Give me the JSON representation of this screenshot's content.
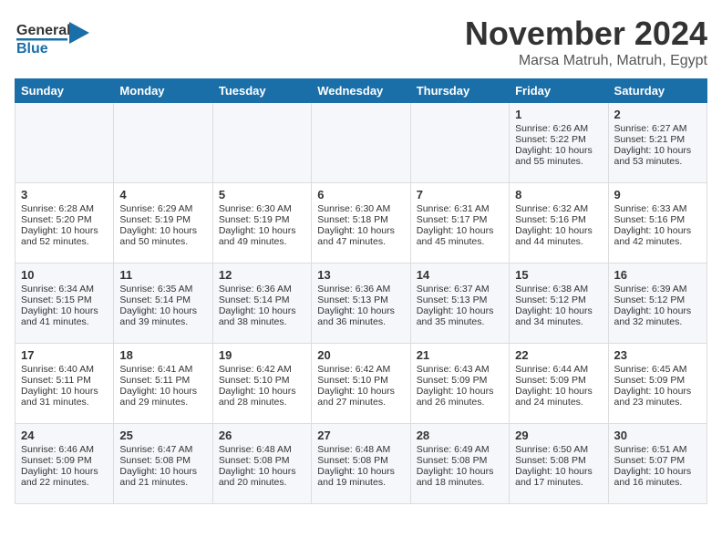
{
  "header": {
    "logo_line1": "General",
    "logo_line2": "Blue",
    "month": "November 2024",
    "location": "Marsa Matruh, Matruh, Egypt"
  },
  "days_of_week": [
    "Sunday",
    "Monday",
    "Tuesday",
    "Wednesday",
    "Thursday",
    "Friday",
    "Saturday"
  ],
  "weeks": [
    [
      {
        "day": "",
        "info": ""
      },
      {
        "day": "",
        "info": ""
      },
      {
        "day": "",
        "info": ""
      },
      {
        "day": "",
        "info": ""
      },
      {
        "day": "",
        "info": ""
      },
      {
        "day": "1",
        "info": "Sunrise: 6:26 AM\nSunset: 5:22 PM\nDaylight: 10 hours\nand 55 minutes."
      },
      {
        "day": "2",
        "info": "Sunrise: 6:27 AM\nSunset: 5:21 PM\nDaylight: 10 hours\nand 53 minutes."
      }
    ],
    [
      {
        "day": "3",
        "info": "Sunrise: 6:28 AM\nSunset: 5:20 PM\nDaylight: 10 hours\nand 52 minutes."
      },
      {
        "day": "4",
        "info": "Sunrise: 6:29 AM\nSunset: 5:19 PM\nDaylight: 10 hours\nand 50 minutes."
      },
      {
        "day": "5",
        "info": "Sunrise: 6:30 AM\nSunset: 5:19 PM\nDaylight: 10 hours\nand 49 minutes."
      },
      {
        "day": "6",
        "info": "Sunrise: 6:30 AM\nSunset: 5:18 PM\nDaylight: 10 hours\nand 47 minutes."
      },
      {
        "day": "7",
        "info": "Sunrise: 6:31 AM\nSunset: 5:17 PM\nDaylight: 10 hours\nand 45 minutes."
      },
      {
        "day": "8",
        "info": "Sunrise: 6:32 AM\nSunset: 5:16 PM\nDaylight: 10 hours\nand 44 minutes."
      },
      {
        "day": "9",
        "info": "Sunrise: 6:33 AM\nSunset: 5:16 PM\nDaylight: 10 hours\nand 42 minutes."
      }
    ],
    [
      {
        "day": "10",
        "info": "Sunrise: 6:34 AM\nSunset: 5:15 PM\nDaylight: 10 hours\nand 41 minutes."
      },
      {
        "day": "11",
        "info": "Sunrise: 6:35 AM\nSunset: 5:14 PM\nDaylight: 10 hours\nand 39 minutes."
      },
      {
        "day": "12",
        "info": "Sunrise: 6:36 AM\nSunset: 5:14 PM\nDaylight: 10 hours\nand 38 minutes."
      },
      {
        "day": "13",
        "info": "Sunrise: 6:36 AM\nSunset: 5:13 PM\nDaylight: 10 hours\nand 36 minutes."
      },
      {
        "day": "14",
        "info": "Sunrise: 6:37 AM\nSunset: 5:13 PM\nDaylight: 10 hours\nand 35 minutes."
      },
      {
        "day": "15",
        "info": "Sunrise: 6:38 AM\nSunset: 5:12 PM\nDaylight: 10 hours\nand 34 minutes."
      },
      {
        "day": "16",
        "info": "Sunrise: 6:39 AM\nSunset: 5:12 PM\nDaylight: 10 hours\nand 32 minutes."
      }
    ],
    [
      {
        "day": "17",
        "info": "Sunrise: 6:40 AM\nSunset: 5:11 PM\nDaylight: 10 hours\nand 31 minutes."
      },
      {
        "day": "18",
        "info": "Sunrise: 6:41 AM\nSunset: 5:11 PM\nDaylight: 10 hours\nand 29 minutes."
      },
      {
        "day": "19",
        "info": "Sunrise: 6:42 AM\nSunset: 5:10 PM\nDaylight: 10 hours\nand 28 minutes."
      },
      {
        "day": "20",
        "info": "Sunrise: 6:42 AM\nSunset: 5:10 PM\nDaylight: 10 hours\nand 27 minutes."
      },
      {
        "day": "21",
        "info": "Sunrise: 6:43 AM\nSunset: 5:09 PM\nDaylight: 10 hours\nand 26 minutes."
      },
      {
        "day": "22",
        "info": "Sunrise: 6:44 AM\nSunset: 5:09 PM\nDaylight: 10 hours\nand 24 minutes."
      },
      {
        "day": "23",
        "info": "Sunrise: 6:45 AM\nSunset: 5:09 PM\nDaylight: 10 hours\nand 23 minutes."
      }
    ],
    [
      {
        "day": "24",
        "info": "Sunrise: 6:46 AM\nSunset: 5:09 PM\nDaylight: 10 hours\nand 22 minutes."
      },
      {
        "day": "25",
        "info": "Sunrise: 6:47 AM\nSunset: 5:08 PM\nDaylight: 10 hours\nand 21 minutes."
      },
      {
        "day": "26",
        "info": "Sunrise: 6:48 AM\nSunset: 5:08 PM\nDaylight: 10 hours\nand 20 minutes."
      },
      {
        "day": "27",
        "info": "Sunrise: 6:48 AM\nSunset: 5:08 PM\nDaylight: 10 hours\nand 19 minutes."
      },
      {
        "day": "28",
        "info": "Sunrise: 6:49 AM\nSunset: 5:08 PM\nDaylight: 10 hours\nand 18 minutes."
      },
      {
        "day": "29",
        "info": "Sunrise: 6:50 AM\nSunset: 5:08 PM\nDaylight: 10 hours\nand 17 minutes."
      },
      {
        "day": "30",
        "info": "Sunrise: 6:51 AM\nSunset: 5:07 PM\nDaylight: 10 hours\nand 16 minutes."
      }
    ]
  ]
}
